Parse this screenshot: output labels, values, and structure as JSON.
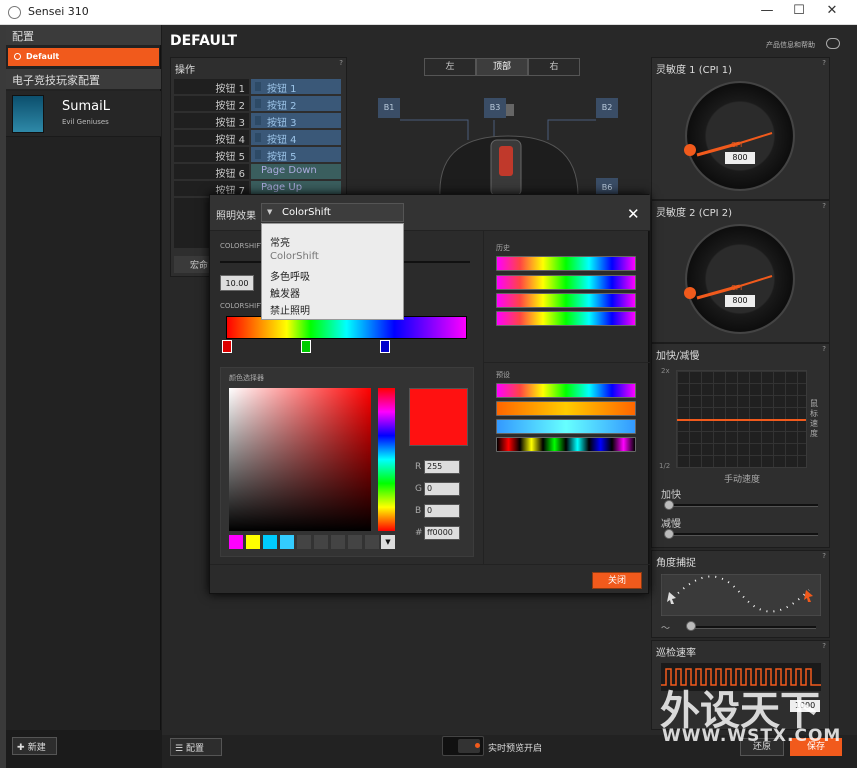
{
  "window": {
    "title": "Sensei 310",
    "minimize": "—",
    "maximize": "☐",
    "close": "✕"
  },
  "sidebar": {
    "config_header": "配置",
    "default_item": "Default",
    "pro_header": "电子竞技玩家配置",
    "pro_player": {
      "name": "SumaiL",
      "team": "Evil Geniuses"
    },
    "new_button": "新建"
  },
  "main": {
    "title": "DEFAULT",
    "info_label": "产品信息和帮助",
    "actions_panel": {
      "title": "操作",
      "rows": [
        {
          "button": "按钮 1",
          "assign": "按钮 1"
        },
        {
          "button": "按钮 2",
          "assign": "按钮 2"
        },
        {
          "button": "按钮 3",
          "assign": "按钮 3"
        },
        {
          "button": "按钮 4",
          "assign": "按钮 4"
        },
        {
          "button": "按钮 5",
          "assign": "按钮 5"
        },
        {
          "button": "按钮 6",
          "assign": "Page Down"
        },
        {
          "button": "按钮 7",
          "assign": "Page Up"
        }
      ],
      "macro_label": "宏命"
    },
    "view_tabs": [
      "左",
      "顶部",
      "右"
    ],
    "active_tab": "顶部",
    "mouse_labels": {
      "b1": "B1",
      "b2": "B2",
      "b3": "B3",
      "b6": "B6"
    }
  },
  "lighting_dialog": {
    "label": "照明效果",
    "selected": "ColorShift",
    "options": [
      "常亮",
      "ColorShift",
      "多色呼吸",
      "触发器",
      "禁止照明"
    ],
    "colorshift_label_1": "COLORSHIFT",
    "colorshift_label_2": "COLORSHIFT",
    "speed_value": "10.00",
    "picker_label": "颜色选择器",
    "history_label": "历史",
    "preset_label": "预设",
    "rgb": {
      "r_label": "R",
      "r": "255",
      "g_label": "G",
      "g": "0",
      "b_label": "B",
      "b": "0",
      "hex_label": "#",
      "hex": "ff0000"
    },
    "close_button": "关闭",
    "swatch_colors": [
      "#ff00ff",
      "#ffff00",
      "#00ccff",
      "#33ccff",
      "#444444",
      "#444444",
      "#444444",
      "#444444",
      "#444444"
    ],
    "current_color": "#ff1111"
  },
  "right_panels": {
    "cpi1": {
      "title": "灵敏度 1 (CPI 1)",
      "unit": "CPI",
      "value": "800"
    },
    "cpi2": {
      "title": "灵敏度 2 (CPI 2)",
      "unit": "CPI",
      "value": "800"
    },
    "accel": {
      "title": "加快/减慢",
      "y_top": "2x",
      "y_bottom": "1/2",
      "x_label": "手动速度",
      "y_label": "鼠标速度",
      "accel_label": "加快",
      "decel_label": "减慢"
    },
    "angle": {
      "title": "角度捕捉"
    },
    "polling": {
      "title": "巡检速率",
      "value": "1000"
    }
  },
  "bottom": {
    "config_button": "配置",
    "live_preview": "实时预览开启",
    "revert": "还原",
    "save": "保存"
  },
  "watermark": {
    "text": "外设天下",
    "url": "WWW.WSTX.COM"
  },
  "colors": {
    "accent": "#f15a1c",
    "assign_blue": "#3a5878"
  }
}
